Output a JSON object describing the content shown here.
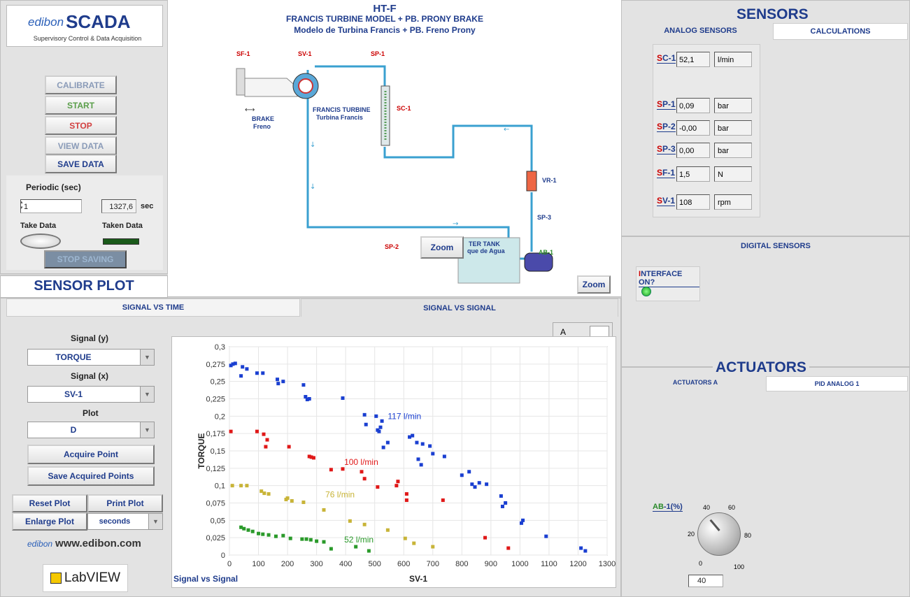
{
  "brand": {
    "prefix": "edibon",
    "name": "SCADA",
    "subtitle": "Supervisory Control & Data Acquisition",
    "www": "www.edibon.com",
    "labview": "LabVIEW"
  },
  "controls": {
    "calibrate": "CALIBRATE",
    "start": "START",
    "stop": "STOP",
    "view_data": "VIEW DATA",
    "save_data": "SAVE DATA",
    "stop_saving": "STOP SAVING"
  },
  "periodic": {
    "label": "Periodic (sec)",
    "value": "1",
    "elapsed": "1327,6",
    "unit": "sec",
    "take_data": "Take Data",
    "taken_data": "Taken Data"
  },
  "diagram": {
    "title": "HT-F",
    "subtitle_en": "FRANCIS TURBINE MODEL + PB. PRONY BRAKE",
    "subtitle_es": "Modelo de Turbina Francis + PB. Freno Prony",
    "labels": {
      "sf1": "SF-1",
      "sv1": "SV-1",
      "sp1": "SP-1",
      "sc1": "SC-1",
      "sp2": "SP-2",
      "sp3": "SP-3",
      "vr1": "VR-1",
      "ab1": "AB-1",
      "brake_en": "BRAKE",
      "brake_es": "Freno",
      "turbine_en": "FRANCIS TURBINE",
      "turbine_es": "Turbina Francis",
      "tank_en": "TER TANK",
      "tank_es": "que de Agua"
    },
    "zoom1": "Zoom",
    "zoom2": "Zoom"
  },
  "sensors": {
    "title": "SENSORS",
    "tabs": [
      "ANALOG SENSORS",
      "CALCULATIONS"
    ],
    "items": [
      {
        "pre": "S",
        "id": "C-1",
        "value": "52,1",
        "unit": "l/min"
      },
      {
        "pre": "S",
        "id": "P-1",
        "value": "0,09",
        "unit": "bar"
      },
      {
        "pre": "S",
        "id": "P-2",
        "value": "-0,00",
        "unit": "bar"
      },
      {
        "pre": "S",
        "id": "P-3",
        "value": "0,00",
        "unit": "bar"
      },
      {
        "pre": "S",
        "id": "F-1",
        "value": "1,5",
        "unit": "N"
      },
      {
        "pre": "S",
        "id": "V-1",
        "value": "108",
        "unit": "rpm"
      }
    ],
    "digital_title": "DIGITAL SENSORS",
    "interface_pre": "I",
    "interface": "NTERFACE ON?"
  },
  "actuators": {
    "title": "ACTUATORS",
    "tabs": [
      "ACTUATORS A",
      "PID ANALOG 1"
    ],
    "ab_label_pre": "AB",
    "ab_label": "-1(%)",
    "knob_ticks": [
      "0",
      "20",
      "40",
      "60",
      "80",
      "100"
    ],
    "value": "40"
  },
  "plot": {
    "title": "SENSOR PLOT",
    "tabs": [
      "SIGNAL VS TIME",
      "SIGNAL VS SIGNAL"
    ],
    "signal_y_label": "Signal (y)",
    "signal_y": "TORQUE",
    "signal_x_label": "Signal (x)",
    "signal_x": "SV-1",
    "plot_label": "Plot",
    "plot_value": "D",
    "acquire": "Acquire Point",
    "save_points": "Save Acquired Points",
    "reset": "Reset Plot",
    "print": "Print Plot",
    "enlarge": "Enlarge Plot",
    "units": "seconds",
    "caption": "Signal vs Signal",
    "scroll_label": "A"
  },
  "chart_data": {
    "type": "scatter",
    "xlabel": "SV-1",
    "ylabel": "TORQUE",
    "xlim": [
      0,
      1300
    ],
    "ylim": [
      0,
      0.3
    ],
    "xticks": [
      0,
      100,
      200,
      300,
      400,
      500,
      600,
      700,
      800,
      900,
      1000,
      1100,
      1200,
      1300
    ],
    "yticks": [
      "0",
      "0,025",
      "0,05",
      "0,075",
      "0,1",
      "0,125",
      "0,15",
      "0,175",
      "0,2",
      "0,225",
      "0,25",
      "0,275",
      "0,3"
    ],
    "grid": true,
    "series": [
      {
        "name": "117 l/min",
        "color": "#1a3fd1",
        "points": [
          [
            5,
            0.273
          ],
          [
            12,
            0.275
          ],
          [
            20,
            0.276
          ],
          [
            40,
            0.258
          ],
          [
            45,
            0.271
          ],
          [
            60,
            0.268
          ],
          [
            95,
            0.262
          ],
          [
            115,
            0.262
          ],
          [
            165,
            0.253
          ],
          [
            168,
            0.247
          ],
          [
            185,
            0.25
          ],
          [
            255,
            0.245
          ],
          [
            262,
            0.228
          ],
          [
            268,
            0.224
          ],
          [
            275,
            0.225
          ],
          [
            390,
            0.226
          ],
          [
            465,
            0.202
          ],
          [
            470,
            0.188
          ],
          [
            505,
            0.2
          ],
          [
            510,
            0.18
          ],
          [
            515,
            0.178
          ],
          [
            520,
            0.184
          ],
          [
            525,
            0.193
          ],
          [
            530,
            0.155
          ],
          [
            545,
            0.162
          ],
          [
            620,
            0.17
          ],
          [
            630,
            0.172
          ],
          [
            645,
            0.162
          ],
          [
            665,
            0.16
          ],
          [
            650,
            0.138
          ],
          [
            660,
            0.13
          ],
          [
            690,
            0.157
          ],
          [
            700,
            0.146
          ],
          [
            740,
            0.142
          ],
          [
            800,
            0.115
          ],
          [
            825,
            0.12
          ],
          [
            835,
            0.102
          ],
          [
            845,
            0.098
          ],
          [
            860,
            0.104
          ],
          [
            885,
            0.102
          ],
          [
            935,
            0.085
          ],
          [
            940,
            0.07
          ],
          [
            950,
            0.075
          ],
          [
            1005,
            0.046
          ],
          [
            1010,
            0.05
          ],
          [
            1090,
            0.027
          ],
          [
            1210,
            0.01
          ],
          [
            1225,
            0.006
          ]
        ]
      },
      {
        "name": "100 l/min",
        "color": "#e01818",
        "points": [
          [
            5,
            0.178
          ],
          [
            95,
            0.178
          ],
          [
            118,
            0.174
          ],
          [
            125,
            0.156
          ],
          [
            130,
            0.166
          ],
          [
            205,
            0.156
          ],
          [
            275,
            0.142
          ],
          [
            282,
            0.141
          ],
          [
            290,
            0.14
          ],
          [
            350,
            0.123
          ],
          [
            390,
            0.124
          ],
          [
            455,
            0.12
          ],
          [
            465,
            0.11
          ],
          [
            510,
            0.098
          ],
          [
            575,
            0.1
          ],
          [
            580,
            0.106
          ],
          [
            610,
            0.079
          ],
          [
            610,
            0.088
          ],
          [
            735,
            0.079
          ],
          [
            880,
            0.025
          ],
          [
            960,
            0.01
          ]
        ]
      },
      {
        "name": "76 l/min",
        "color": "#c8b438",
        "points": [
          [
            10,
            0.1
          ],
          [
            40,
            0.1
          ],
          [
            60,
            0.1
          ],
          [
            110,
            0.092
          ],
          [
            120,
            0.089
          ],
          [
            135,
            0.088
          ],
          [
            195,
            0.08
          ],
          [
            200,
            0.082
          ],
          [
            215,
            0.078
          ],
          [
            255,
            0.076
          ],
          [
            325,
            0.065
          ],
          [
            415,
            0.049
          ],
          [
            465,
            0.044
          ],
          [
            545,
            0.036
          ],
          [
            605,
            0.024
          ],
          [
            635,
            0.017
          ],
          [
            700,
            0.012
          ]
        ]
      },
      {
        "name": "52 l/min",
        "color": "#2a9a2a",
        "points": [
          [
            40,
            0.04
          ],
          [
            50,
            0.038
          ],
          [
            65,
            0.036
          ],
          [
            80,
            0.034
          ],
          [
            100,
            0.031
          ],
          [
            115,
            0.03
          ],
          [
            135,
            0.029
          ],
          [
            160,
            0.027
          ],
          [
            185,
            0.028
          ],
          [
            210,
            0.024
          ],
          [
            250,
            0.023
          ],
          [
            265,
            0.023
          ],
          [
            280,
            0.022
          ],
          [
            300,
            0.02
          ],
          [
            325,
            0.019
          ],
          [
            350,
            0.009
          ],
          [
            435,
            0.012
          ],
          [
            480,
            0.006
          ]
        ]
      }
    ]
  }
}
